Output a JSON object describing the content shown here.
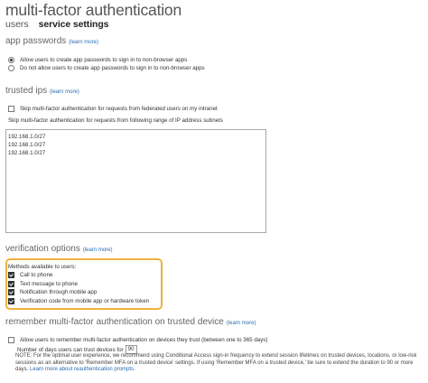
{
  "page_title": "multi-factor authentication",
  "tabs": [
    {
      "label": "users"
    },
    {
      "label": "service settings"
    }
  ],
  "learn_more": "(learn more)",
  "app_passwords": {
    "title": "app passwords",
    "options": [
      {
        "label": "Allow users to create app passwords to sign in to non-browser apps",
        "selected": true
      },
      {
        "label": "Do not allow users to create app passwords to sign in to non-browser apps",
        "selected": false
      }
    ]
  },
  "trusted_ips": {
    "title": "trusted ips",
    "skip_federated_label": "Skip multi-factor authentication for requests from federated users on my intranet",
    "skip_range_label": "Skip multi-factor authentication for requests from following range of IP address subnets",
    "ip_list": [
      "192.168.1.0/27",
      "192.168.1.0/27",
      "192.168.1.0/27"
    ]
  },
  "verification_options": {
    "title": "verification options",
    "methods_label": "Methods available to users:",
    "methods": [
      {
        "label": "Call to phone",
        "checked": true
      },
      {
        "label": "Text message to phone",
        "checked": true
      },
      {
        "label": "Notification through mobile app",
        "checked": true
      },
      {
        "label": "Verification code from mobile app or hardware token",
        "checked": true
      }
    ]
  },
  "remember_mfa": {
    "title": "remember multi-factor authentication on trusted device",
    "allow_label": "Allow users to remember multi-factor authentication on devices they trust (between one to 365 days)",
    "days_label": "Number of days users can trust devices for",
    "days_value": "90",
    "note": "NOTE: For the optimal user experience, we recommend using Conditional Access sign-in frequency to extend session lifetimes on trusted devices, locations, or low-risk sessions as an alternative to 'Remember MFA on a trusted device' settings. If using 'Remember MFA on a trusted device,' be sure to extend the duration to 90 or more days.",
    "note_link": "Learn more about reauthentication prompts."
  },
  "colors": {
    "highlight": "#f0b040",
    "link": "#2b6cb0"
  }
}
